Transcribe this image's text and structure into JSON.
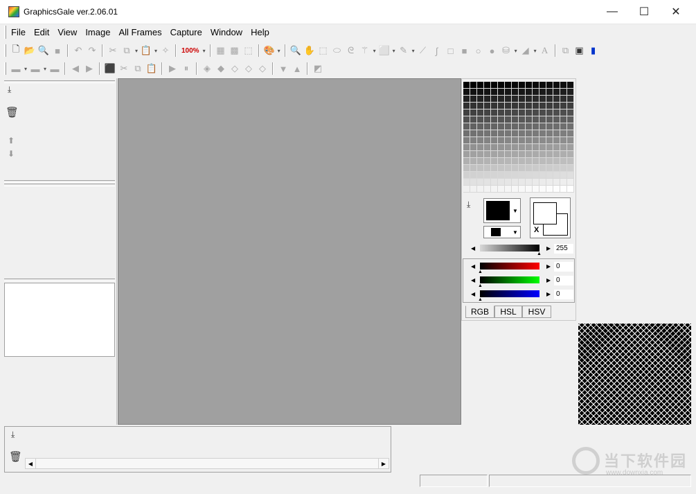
{
  "window": {
    "title": "GraphicsGale ver.2.06.01",
    "minimize_glyph": "—",
    "maximize_glyph": "☐",
    "close_glyph": "✕"
  },
  "menu": [
    "File",
    "Edit",
    "View",
    "Image",
    "All Frames",
    "Capture",
    "Window",
    "Help"
  ],
  "toolbar": {
    "zoom_label": "100%"
  },
  "color_panel": {
    "gray_value": "255",
    "red_value": "0",
    "green_value": "0",
    "blue_value": "0",
    "swap_label": "X",
    "tabs": [
      "RGB",
      "HSL",
      "HSV"
    ],
    "active_tab": "RGB",
    "colors": {
      "red_slider_end": "#ff0000",
      "green_slider_end": "#00ff00",
      "blue_slider_end": "#0000ff",
      "canvas_bg": "#a0a0a0"
    }
  },
  "watermark": {
    "text_cn": "当下软件园",
    "text_url": "www.downxia.com"
  }
}
